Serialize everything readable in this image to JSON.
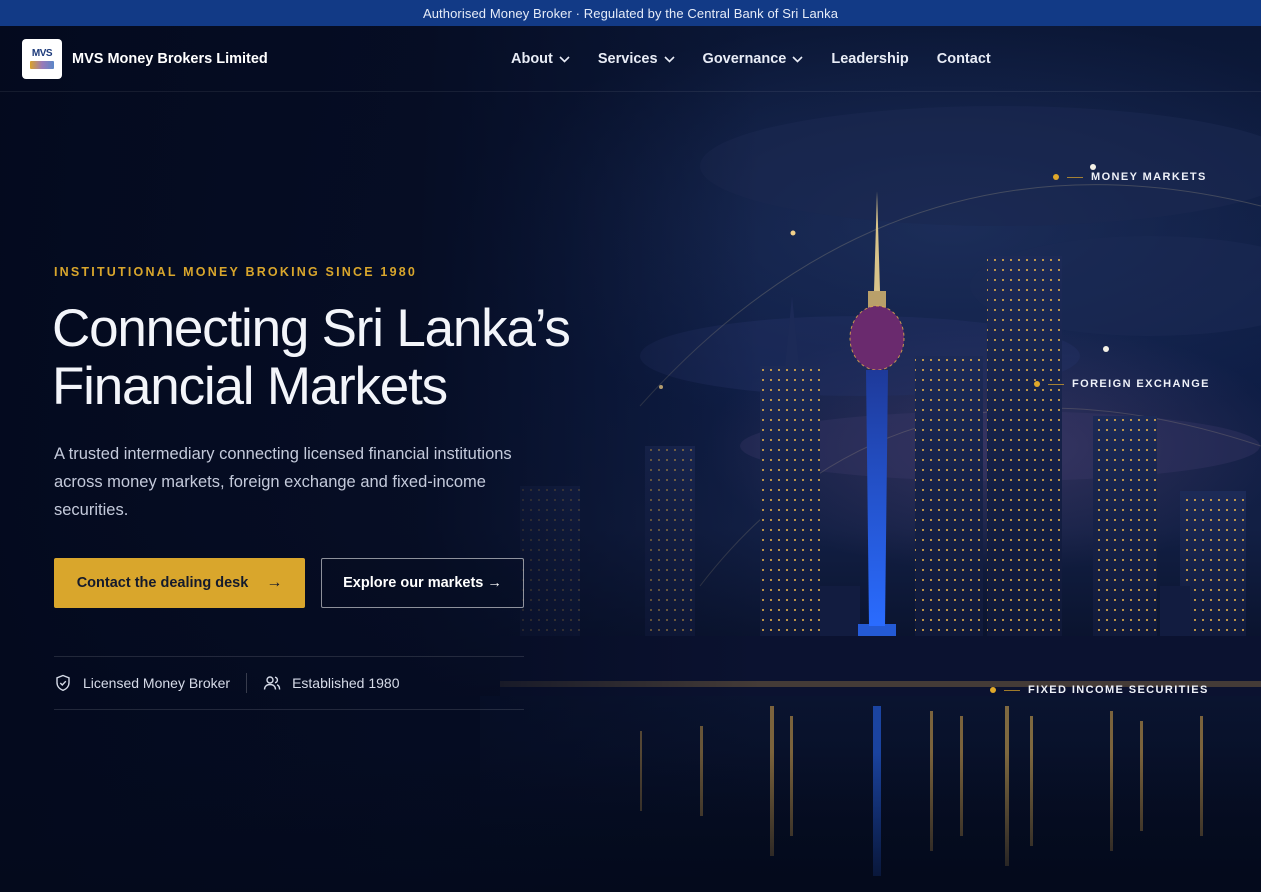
{
  "topbar": {
    "text": "Authorised Money Broker · Regulated by the Central Bank of Sri Lanka"
  },
  "brand": {
    "logo_text": "MVS",
    "name": "MVS Money Brokers Limited"
  },
  "nav": {
    "items": [
      {
        "label": "About",
        "icon": "chevron-down-icon"
      },
      {
        "label": "Services",
        "icon": "chevron-down-icon"
      },
      {
        "label": "Governance",
        "icon": "chevron-down-icon"
      },
      {
        "label": "Leadership"
      },
      {
        "label": "Contact"
      }
    ]
  },
  "hero": {
    "eyebrow": "INSTITUTIONAL MONEY BROKING SINCE 1980",
    "headline_line1": "Connecting Sri Lanka’s",
    "headline_line2": "Financial Markets",
    "subtext": "A trusted intermediary connecting licensed financial institutions across money markets, foreign exchange and fixed-income securities.",
    "primary_cta": "Contact the dealing desk",
    "primary_cta_arrow": "→",
    "secondary_cta": "Explore our markets",
    "secondary_cta_arrow": "→",
    "trust": [
      {
        "label": "Licensed Money Broker",
        "icon": "shield-icon"
      },
      {
        "label": "Established 1980",
        "icon": "users-icon"
      }
    ]
  },
  "markets": {
    "money": "MONEY MARKETS",
    "fx": "FOREIGN EXCHANGE",
    "fixed_income": "FIXED INCOME SECURITIES"
  },
  "colors": {
    "topbar": "#123a86",
    "accent": "#d9a62c",
    "background": "#050d24"
  }
}
